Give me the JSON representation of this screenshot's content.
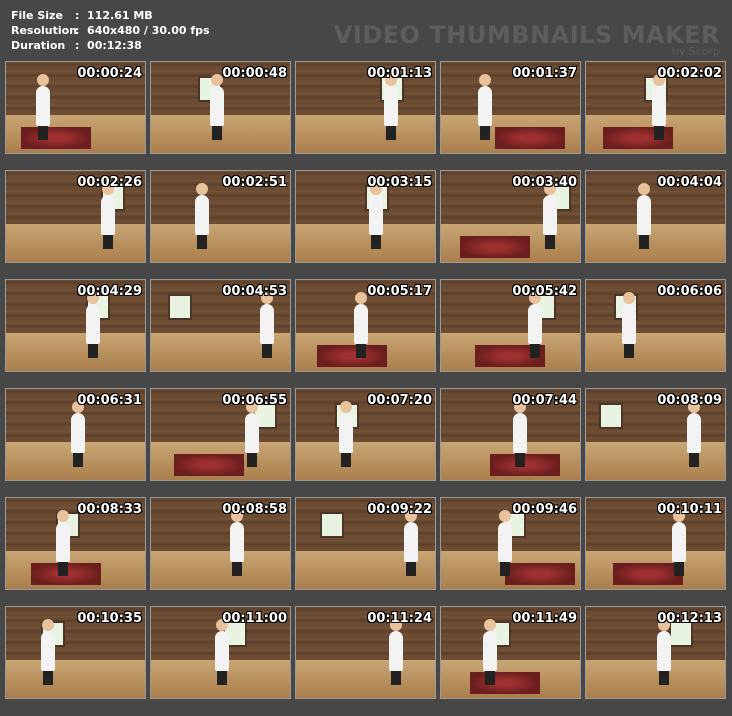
{
  "info": {
    "file_size_label": "File Size",
    "file_size_value": ":  112.61 MB",
    "resolution_label": "Resolution",
    "resolution_value": ":  640x480 / 30.00 fps",
    "duration_label": "Duration",
    "duration_value": ":  00:12:38"
  },
  "brand": {
    "title": "VIDEO THUMBNAILS MAKER",
    "subtitle": "by Scorp"
  },
  "thumbnails": [
    "00:00:24",
    "00:00:48",
    "00:01:13",
    "00:01:37",
    "00:02:02",
    "00:02:26",
    "00:02:51",
    "00:03:15",
    "00:03:40",
    "00:04:04",
    "00:04:29",
    "00:04:53",
    "00:05:17",
    "00:05:42",
    "00:06:06",
    "00:06:31",
    "00:06:55",
    "00:07:20",
    "00:07:44",
    "00:08:09",
    "00:08:33",
    "00:08:58",
    "00:09:22",
    "00:09:46",
    "00:10:11",
    "00:10:35",
    "00:11:00",
    "00:11:24",
    "00:11:49",
    "00:12:13"
  ]
}
